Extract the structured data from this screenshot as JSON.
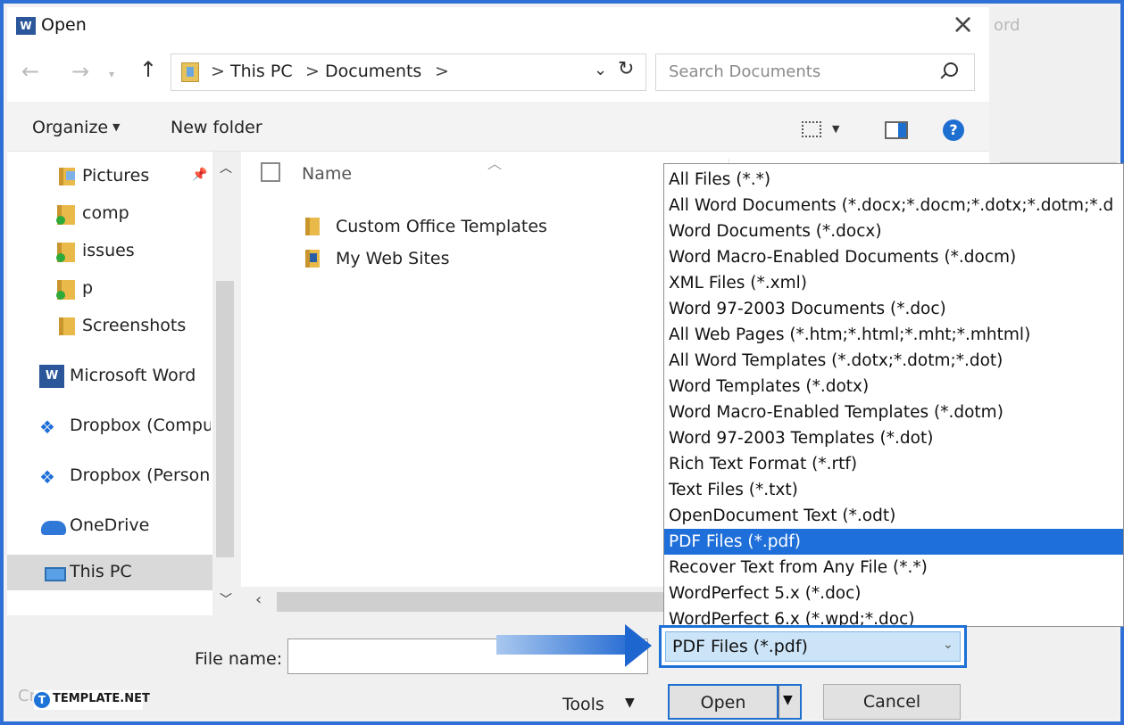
{
  "dialog": {
    "title": "Open",
    "background_app_text": "ord"
  },
  "address_bar": {
    "segments": [
      "This PC",
      "Documents"
    ],
    "separator": ">"
  },
  "search": {
    "placeholder": "Search Documents"
  },
  "toolbar": {
    "organize": "Organize",
    "new_folder": "New folder",
    "help": "?"
  },
  "nav_pane": {
    "items": [
      {
        "label": "Pictures",
        "icon": "pictures-folder-icon"
      },
      {
        "label": "comp",
        "icon": "synced-folder-icon"
      },
      {
        "label": "issues",
        "icon": "synced-folder-icon"
      },
      {
        "label": "p",
        "icon": "synced-folder-icon"
      },
      {
        "label": "Screenshots",
        "icon": "folder-icon"
      },
      {
        "label": "Microsoft Word",
        "icon": "word-icon"
      },
      {
        "label": "Dropbox (Compu",
        "icon": "dropbox-icon"
      },
      {
        "label": "Dropbox (Person",
        "icon": "dropbox-icon"
      },
      {
        "label": "OneDrive",
        "icon": "onedrive-cloud-icon"
      },
      {
        "label": "This PC",
        "icon": "computer-icon",
        "selected": true
      }
    ]
  },
  "file_list": {
    "column_name": "Name",
    "rows": [
      {
        "name": "Custom Office Templates",
        "icon": "folder-icon"
      },
      {
        "name": "My Web Sites",
        "icon": "web-folder-icon"
      }
    ]
  },
  "bottom": {
    "file_name_label": "File name:",
    "file_name_value": "",
    "tools_label": "Tools",
    "open_label": "Open",
    "cancel_label": "Cancel"
  },
  "file_type": {
    "selected": "PDF Files (*.pdf)",
    "options": [
      "All Files (*.*)",
      "All Word Documents (*.docx;*.docm;*.dotx;*.dotm;*.d",
      "Word Documents (*.docx)",
      "Word Macro-Enabled Documents (*.docm)",
      "XML Files (*.xml)",
      "Word 97-2003 Documents (*.doc)",
      "All Web Pages (*.htm;*.html;*.mht;*.mhtml)",
      "All Word Templates (*.dotx;*.dotm;*.dot)",
      "Word Templates (*.dotx)",
      "Word Macro-Enabled Templates (*.dotm)",
      "Word 97-2003 Templates (*.dot)",
      "Rich Text Format (*.rtf)",
      "Text Files (*.txt)",
      "OpenDocument Text (*.odt)",
      "PDF Files (*.pdf)",
      "Recover Text from Any File (*.*)",
      "WordPerfect 5.x (*.doc)",
      "WordPerfect 6.x (*.wpd;*.doc)"
    ],
    "highlighted_index": 14
  },
  "watermark": {
    "text": "Cre        pe.com",
    "logo_badge": "T",
    "logo_text": "TEMPLATE.NET"
  },
  "colors": {
    "accent": "#1e6fd9",
    "frame": "#2f6fd6"
  }
}
